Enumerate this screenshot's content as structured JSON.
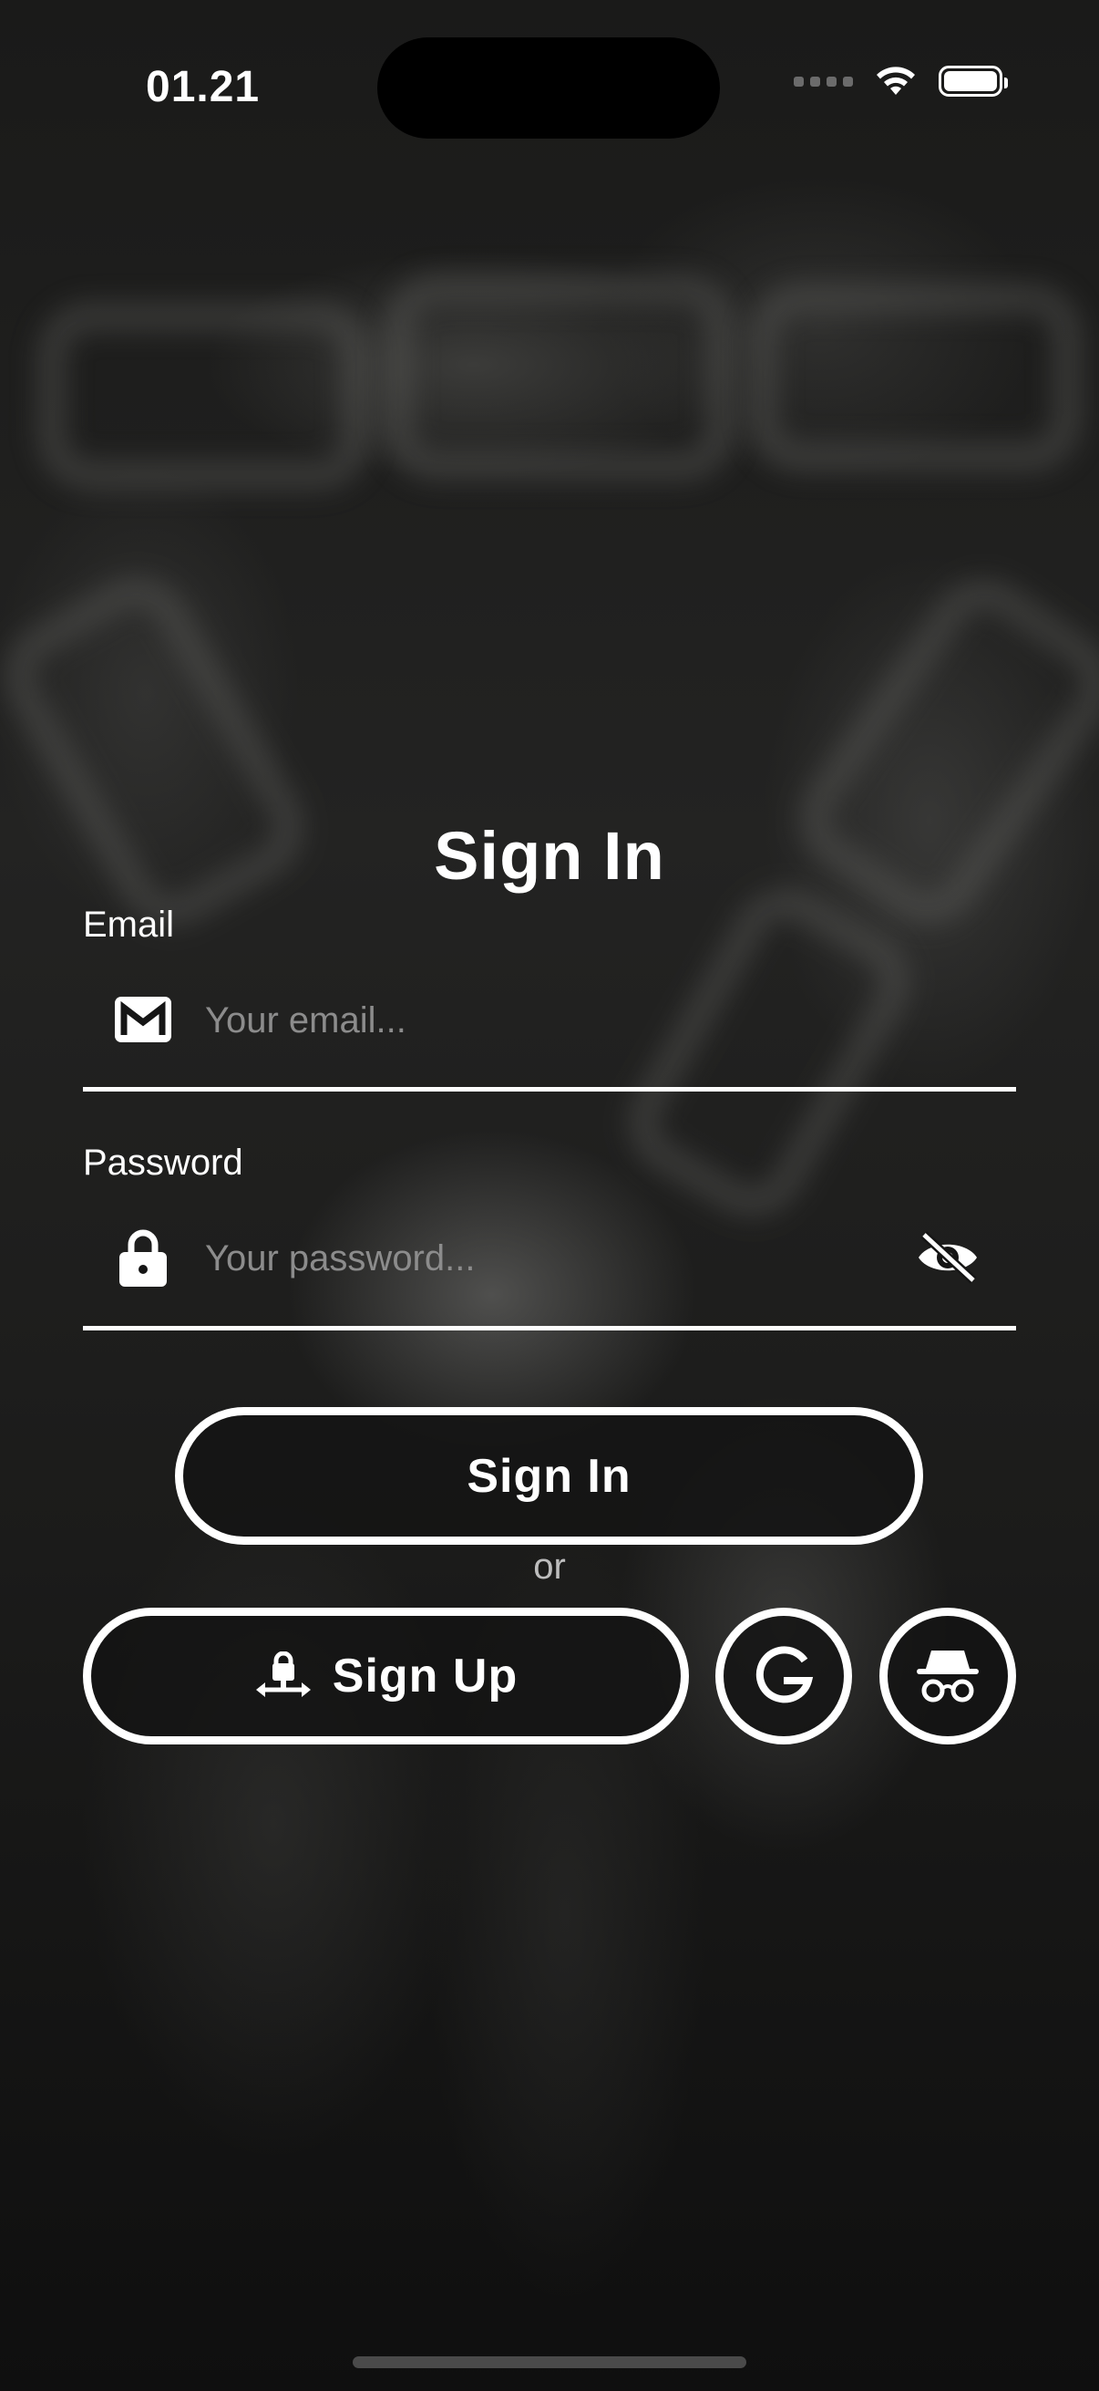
{
  "status_bar": {
    "time": "01.21",
    "wifi_icon": "wifi-icon",
    "battery_icon": "battery-icon"
  },
  "signin": {
    "title": "Sign In",
    "email": {
      "label": "Email",
      "placeholder": "Your email...",
      "value": "",
      "icon": "gmail-icon"
    },
    "password": {
      "label": "Password",
      "placeholder": "Your password...",
      "value": "",
      "icon": "lock-icon",
      "toggle_icon": "eye-slash-icon"
    },
    "submit_label": "Sign In",
    "or_text": "or",
    "signup_label": "Sign Up",
    "signup_icon": "user-lock-swap-icon",
    "google_icon": "google-icon",
    "anonymous_icon": "incognito-icon"
  },
  "colors": {
    "text": "#ffffff",
    "placeholder": "#8c8c8c",
    "background": "#1c1c1b"
  }
}
